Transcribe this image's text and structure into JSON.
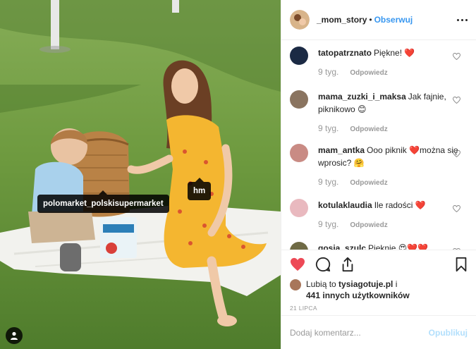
{
  "header": {
    "username": "_mom_story",
    "separator": "•",
    "follow_label": "Obserwuj",
    "more_icon": "more-horizontal-icon"
  },
  "photo": {
    "tags": [
      {
        "label": "polomarket_polskisupermarket"
      },
      {
        "label": "hm"
      }
    ],
    "user_tag_icon": "person-icon"
  },
  "comments": [
    {
      "user": "tatopatrznato",
      "text": "Piękne! ❤️",
      "age": "9 tyg.",
      "reply": "Odpowiedz",
      "avatar_color": "#1b2a44"
    },
    {
      "user": "mama_zuzki_i_maksa",
      "text": "Jak fajnie, piknikowo 😊",
      "age": "9 tyg.",
      "reply": "Odpowiedz",
      "avatar_color": "#8a7460"
    },
    {
      "user": "mam_antka",
      "text": "Ooo piknik ❤️można się wprosic? 🤗",
      "age": "9 tyg.",
      "reply": "Odpowiedz",
      "avatar_color": "#c98b84"
    },
    {
      "user": "kotulaklaudia",
      "text": "Ile radości ❤️",
      "age": "9 tyg.",
      "reply": "Odpowiedz",
      "avatar_color": "#e9b9bf"
    },
    {
      "user": "gosia_szulc",
      "text": "Pięknie 😍❤️❤️",
      "age": "",
      "reply": "",
      "avatar_color": "#6f6a45"
    }
  ],
  "likes": {
    "prefix": "Lubią to ",
    "user": "tysiagotuje.pl",
    "and": " i",
    "others": "441 innych użytkowników"
  },
  "date": "21 LIPCA",
  "add_comment": {
    "placeholder": "Dodaj komentarz...",
    "post_label": "Opublikuj"
  },
  "colors": {
    "accent": "#3897f0",
    "like_red": "#ed4956",
    "post_disabled": "#b2dffc",
    "muted": "#999999"
  }
}
